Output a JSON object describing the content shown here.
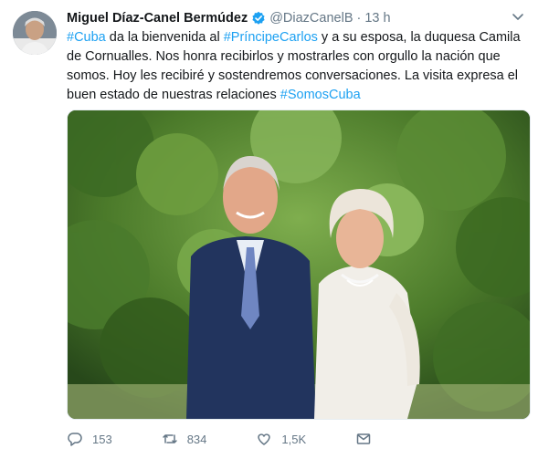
{
  "author": {
    "name": "Miguel Díaz-Canel Bermúdez",
    "handle": "@DiazCanelB",
    "separator": "·",
    "time": "13 h"
  },
  "tweet": {
    "segments": [
      {
        "text": "#Cuba",
        "type": "hashtag"
      },
      {
        "text": " da  la bienvenida al ",
        "type": "text"
      },
      {
        "text": "#PríncipeCarlos",
        "type": "hashtag"
      },
      {
        "text": " y a su esposa, la duquesa Camila de Cornualles. Nos honra recibirlos y mostrarles con orgullo la nación que somos. Hoy les recibiré y sostendremos conversaciones. La visita expresa el buen estado de nuestras relaciones ",
        "type": "text"
      },
      {
        "text": "#SomosCuba",
        "type": "hashtag"
      }
    ]
  },
  "actions": {
    "replies": "153",
    "retweets": "834",
    "likes": "1,5K"
  },
  "colors": {
    "link": "#1da1f2",
    "muted": "#657786",
    "verified": "#1da1f2"
  },
  "icons": [
    "verified-badge-icon",
    "chevron-down-icon",
    "reply-icon",
    "retweet-icon",
    "like-icon",
    "direct-message-icon"
  ]
}
